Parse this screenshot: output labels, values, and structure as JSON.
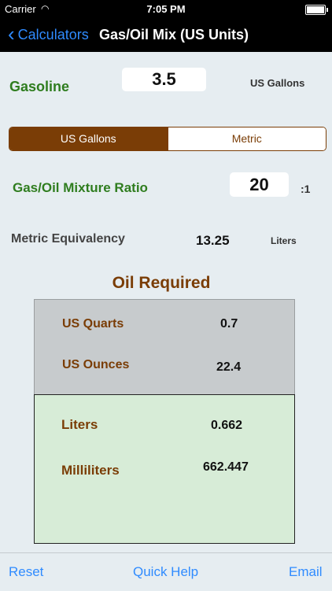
{
  "status_bar": {
    "carrier": "Carrier",
    "time": "7:05 PM"
  },
  "nav": {
    "back_label": "Calculators",
    "title": "Gas/Oil Mix (US Units)"
  },
  "gasoline": {
    "label": "Gasoline",
    "value": "3.5",
    "unit": "US Gallons"
  },
  "unit_toggle": {
    "options": [
      "US Gallons",
      "Metric"
    ],
    "selected": "US Gallons"
  },
  "ratio": {
    "label": "Gas/Oil Mixture Ratio",
    "value": "20",
    "suffix": ":1"
  },
  "metric_equiv": {
    "label": "Metric Equivalency",
    "value": "13.25",
    "unit": "Liters"
  },
  "oil_required": {
    "title": "Oil Required",
    "us_rows": [
      {
        "label": "US Quarts",
        "value": "0.7"
      },
      {
        "label": "US Ounces",
        "value": "22.4"
      }
    ],
    "metric_rows": [
      {
        "label": "Liters",
        "value": "0.662"
      },
      {
        "label": "Milliliters",
        "value": "662.447"
      }
    ]
  },
  "toolbar": {
    "reset": "Reset",
    "help": "Quick Help",
    "email": "Email"
  },
  "colors": {
    "accent": "#2f8bff",
    "brown": "#7a3d06",
    "green": "#2f7d1f"
  }
}
